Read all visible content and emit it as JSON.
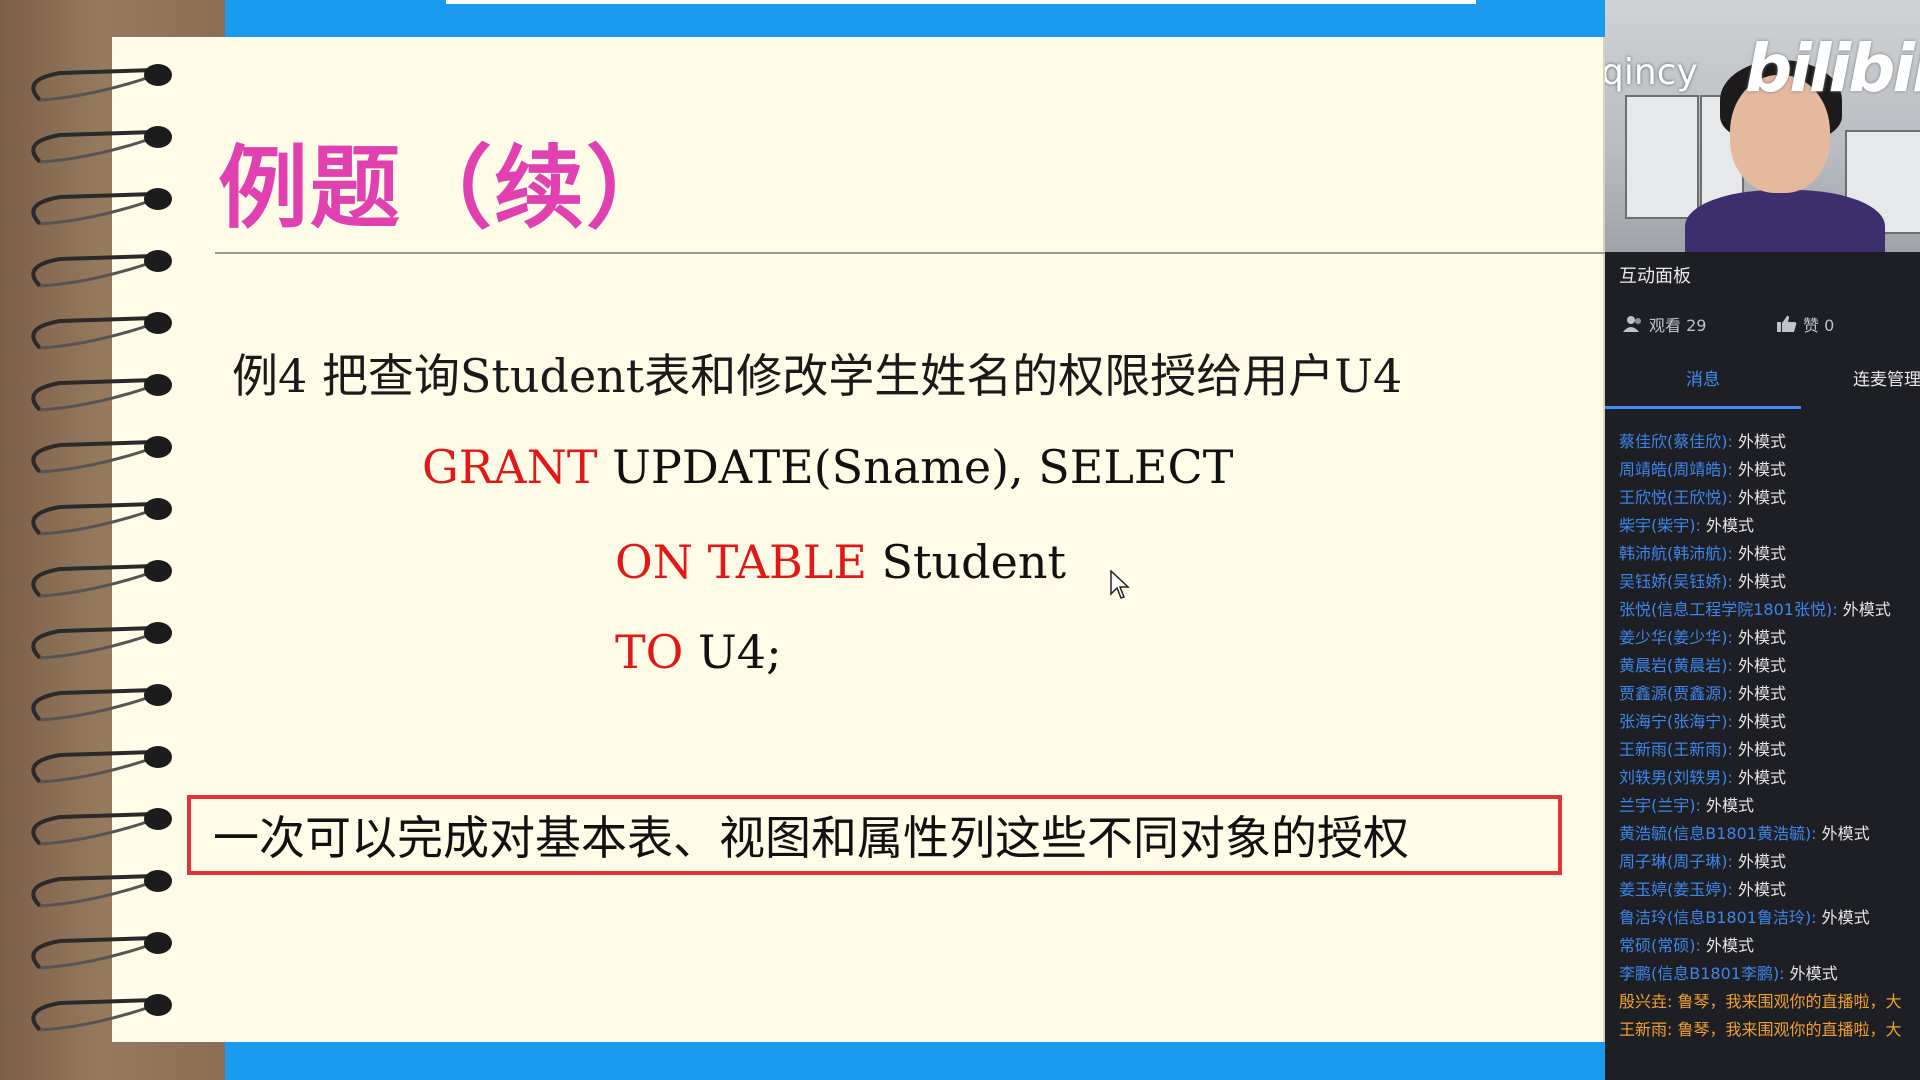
{
  "slide": {
    "title": "例题（续）",
    "example": "例4 把查询Student表和修改学生姓名的权限授给用户U4",
    "code": {
      "line1_kw": "GRANT",
      "line1_rest": " UPDATE(Sname), SELECT",
      "line2_kw": "ON TABLE",
      "line2_rest": " Student",
      "line3_kw": "TO",
      "line3_rest": " U4;"
    },
    "note": "一次可以完成对基本表、视图和属性列这些不同对象的授权"
  },
  "live": {
    "video_username": "qincy",
    "logo": "bilibili",
    "panel_title": "互动面板",
    "viewers_label": "观看 29",
    "likes_label": "赞 0",
    "tabs": [
      "消息",
      "连麦管理"
    ],
    "messages": [
      {
        "user": "蔡佳欣(蔡佳欣):",
        "text": " 外模式"
      },
      {
        "user": "周靖皓(周靖皓):",
        "text": " 外模式"
      },
      {
        "user": "王欣悦(王欣悦):",
        "text": " 外模式"
      },
      {
        "user": "柴宇(柴宇):",
        "text": " 外模式"
      },
      {
        "user": "韩沛航(韩沛航):",
        "text": " 外模式"
      },
      {
        "user": "吴钰娇(吴钰娇):",
        "text": " 外模式"
      },
      {
        "user": "张悦(信息工程学院1801张悦):",
        "text": " 外模式"
      },
      {
        "user": "姜少华(姜少华):",
        "text": " 外模式"
      },
      {
        "user": "黄晨岩(黄晨岩):",
        "text": " 外模式"
      },
      {
        "user": "贾鑫源(贾鑫源):",
        "text": " 外模式"
      },
      {
        "user": "张海宁(张海宁):",
        "text": " 外模式"
      },
      {
        "user": "王新雨(王新雨):",
        "text": " 外模式"
      },
      {
        "user": "刘轶男(刘轶男):",
        "text": " 外模式"
      },
      {
        "user": "兰宇(兰宇):",
        "text": " 外模式"
      },
      {
        "user": "黄浩毓(信息B1801黄浩毓):",
        "text": " 外模式"
      },
      {
        "user": "周子琳(周子琳):",
        "text": " 外模式"
      },
      {
        "user": "姜玉婷(姜玉婷):",
        "text": " 外模式"
      },
      {
        "user": "鲁洁玲(信息B1801鲁洁玲):",
        "text": " 外模式"
      },
      {
        "user": "常硕(常硕):",
        "text": " 外模式"
      },
      {
        "user": "李鹏(信息B1801李鹏):",
        "text": " 外模式"
      },
      {
        "user": "殷兴垚:",
        "text": " 鲁琴，我来围观你的直播啦，大"
      },
      {
        "user": "王新雨:",
        "text": " 鲁琴，我来围观你的直播啦，大"
      }
    ]
  }
}
